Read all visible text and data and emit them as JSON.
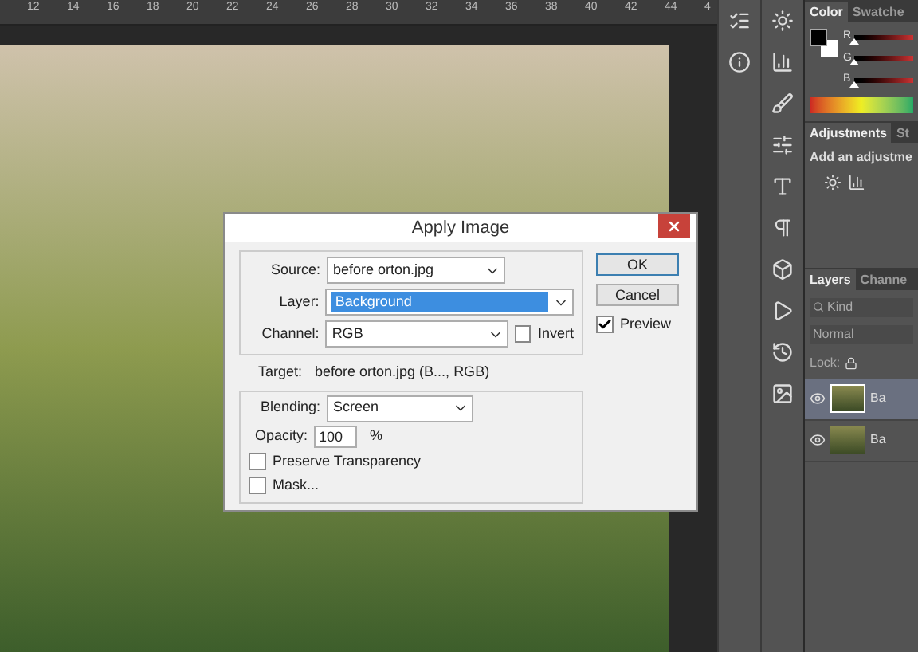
{
  "ruler": {
    "labels": [
      "12",
      "14",
      "16",
      "18",
      "20",
      "22",
      "24",
      "26",
      "28",
      "30",
      "32",
      "34",
      "36",
      "38",
      "40",
      "42",
      "44",
      "4"
    ]
  },
  "dialog": {
    "title": "Apply Image",
    "source": {
      "label": "Source:",
      "value": "before orton.jpg"
    },
    "layer": {
      "label": "Layer:",
      "value": "Background",
      "selected": true
    },
    "channel": {
      "label": "Channel:",
      "value": "RGB"
    },
    "invert": {
      "label": "Invert",
      "checked": false
    },
    "target": {
      "label": "Target:",
      "value": "before orton.jpg (B..., RGB)"
    },
    "blending": {
      "label": "Blending:",
      "value": "Screen"
    },
    "opacity": {
      "label": "Opacity:",
      "value": "100",
      "unit": "%"
    },
    "options": [
      {
        "label": "Preserve Transparency",
        "checked": false
      },
      {
        "label": "Mask...",
        "checked": false
      }
    ],
    "buttons": [
      {
        "label": "OK",
        "default": true
      },
      {
        "label": "Cancel",
        "default": false
      }
    ],
    "preview": {
      "label": "Preview",
      "checked": true
    }
  },
  "panels": {
    "color": {
      "tabs": [
        {
          "label": "Color",
          "selected": true
        },
        {
          "label": "Swatche",
          "selected": false
        }
      ],
      "sliders": [
        {
          "label": "R",
          "level": 0
        },
        {
          "label": "G",
          "level": 0
        },
        {
          "label": "B",
          "level": 0
        }
      ]
    },
    "adjustments": {
      "tabs": [
        {
          "label": "Adjustments",
          "selected": true
        },
        {
          "label": "St",
          "selected": false
        }
      ],
      "heading": "Add an adjustme"
    },
    "layers": {
      "tabs": [
        {
          "label": "Layers",
          "selected": true
        },
        {
          "label": "Channe",
          "selected": false
        }
      ],
      "filter": "Kind",
      "blend_mode": "Normal",
      "lock_label": "Lock:",
      "items": [
        {
          "name": "Ba",
          "selected": true,
          "visible": true
        },
        {
          "name": "Ba",
          "selected": false,
          "visible": true
        }
      ]
    }
  }
}
